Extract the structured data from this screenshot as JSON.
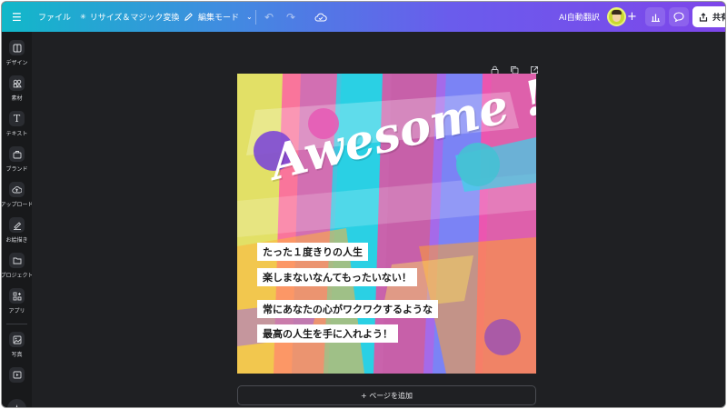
{
  "topbar": {
    "file_label": "ファイル",
    "resize_label": "リサイズ＆マジック変換",
    "edit_mode_label": "編集モード",
    "ai_translate_label": "AI自動翻訳",
    "share_label": "共有"
  },
  "sidebar": {
    "items": [
      {
        "label": "デザイン",
        "icon": "design-icon"
      },
      {
        "label": "素材",
        "icon": "elements-icon"
      },
      {
        "label": "テキスト",
        "icon": "text-icon"
      },
      {
        "label": "ブランド",
        "icon": "brand-icon"
      },
      {
        "label": "アップロード",
        "icon": "upload-icon"
      },
      {
        "label": "お絵描き",
        "icon": "draw-icon"
      },
      {
        "label": "プロジェクト",
        "icon": "folder-icon"
      },
      {
        "label": "アプリ",
        "icon": "apps-icon"
      },
      {
        "label": "写真",
        "icon": "photo-icon"
      },
      {
        "label": "",
        "icon": "video-icon"
      }
    ]
  },
  "design": {
    "headline": "Awesome !",
    "lines": [
      "たった１度きりの人生",
      "楽しまないなんてもったいない！",
      "常にあなたの心がワクワクするような",
      "最高の人生を手に入れよう！"
    ]
  },
  "canvas": {
    "add_page_label": "+ ページを追加"
  },
  "colors": {
    "topbar_start": "#11b8c9",
    "topbar_end": "#7e46ea",
    "sidebar_bg": "#18191b",
    "canvas_bg": "#1f2023"
  }
}
